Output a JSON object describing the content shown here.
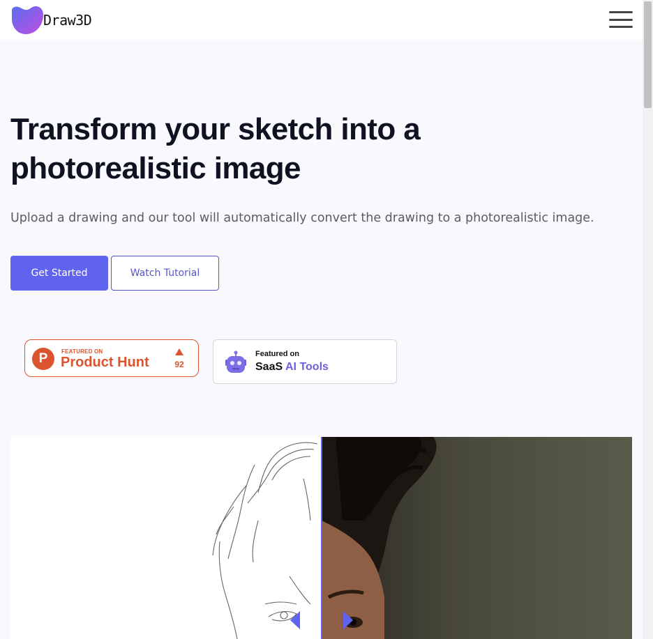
{
  "header": {
    "brand": "Draw3D",
    "logo_gradient": [
      "#5b6cf0",
      "#c04fe0"
    ],
    "menu_icon": "hamburger-menu-icon"
  },
  "hero": {
    "title": "Transform your sketch into a photorealistic image",
    "subtitle": "Upload a drawing and our tool will automatically convert the drawing to a photorealistic image.",
    "primary_button": "Get Started",
    "secondary_button": "Watch Tutorial",
    "accent_color": "#6063ee"
  },
  "badges": {
    "product_hunt": {
      "logo_letter": "P",
      "featured_label": "FEATURED ON",
      "name": "Product Hunt",
      "upvotes": "92",
      "color": "#da552f"
    },
    "saas_ai_tools": {
      "featured_label": "Featured on",
      "name_part1": "SaaS",
      "name_part2": "AI Tools",
      "icon": "robot-icon"
    }
  },
  "comparison": {
    "left": "pencil sketch of man",
    "right": "photorealistic man",
    "handle_left_icon": "arrow-left-icon",
    "handle_right_icon": "arrow-right-icon"
  }
}
